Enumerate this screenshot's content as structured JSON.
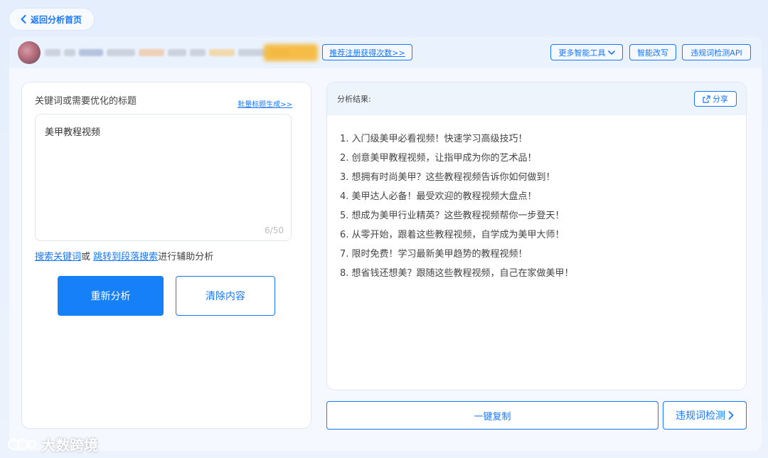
{
  "nav": {
    "back_label": "返回分析首页"
  },
  "user_bar": {
    "register_link": "推荐注册获得次数>>",
    "more_tools": "更多智能工具",
    "smart_rewrite": "智能改写",
    "violation_api": "违规词检测API"
  },
  "left": {
    "label": "关键词或需要优化的标题",
    "batch_link": "批量标题生成>>",
    "input_value": "美甲教程视频",
    "counter": "6/50",
    "hint_link1": "搜索关键词",
    "hint_or": "或",
    "hint_link2": "跳转到段落搜索",
    "hint_rest": "进行辅助分析",
    "reanalyze": "重新分析",
    "clear": "清除内容"
  },
  "right": {
    "header": "分析结果:",
    "share": "分享",
    "results": [
      "1. 入门级美甲必看视频！快速学习高级技巧！",
      "2. 创意美甲教程视频，让指甲成为你的艺术品！",
      "3. 想拥有时尚美甲？这些教程视频告诉你如何做到！",
      "4. 美甲达人必备！最受欢迎的教程视频大盘点！",
      "5. 想成为美甲行业精英？这些教程视频帮你一步登天！",
      "6. 从零开始，跟着这些教程视频，自学成为美甲大师！",
      "7. 限时免费！学习最新美甲趋势的教程视频！",
      "8. 想省钱还想美？跟随这些教程视频，自己在家做美甲！"
    ]
  },
  "actions": {
    "copy": "一键复制",
    "check": "违规词检测"
  },
  "watermark": {
    "text": "大数跨境"
  },
  "colors": {
    "accent": "#1677ff",
    "primary_button": "#1580f7"
  }
}
